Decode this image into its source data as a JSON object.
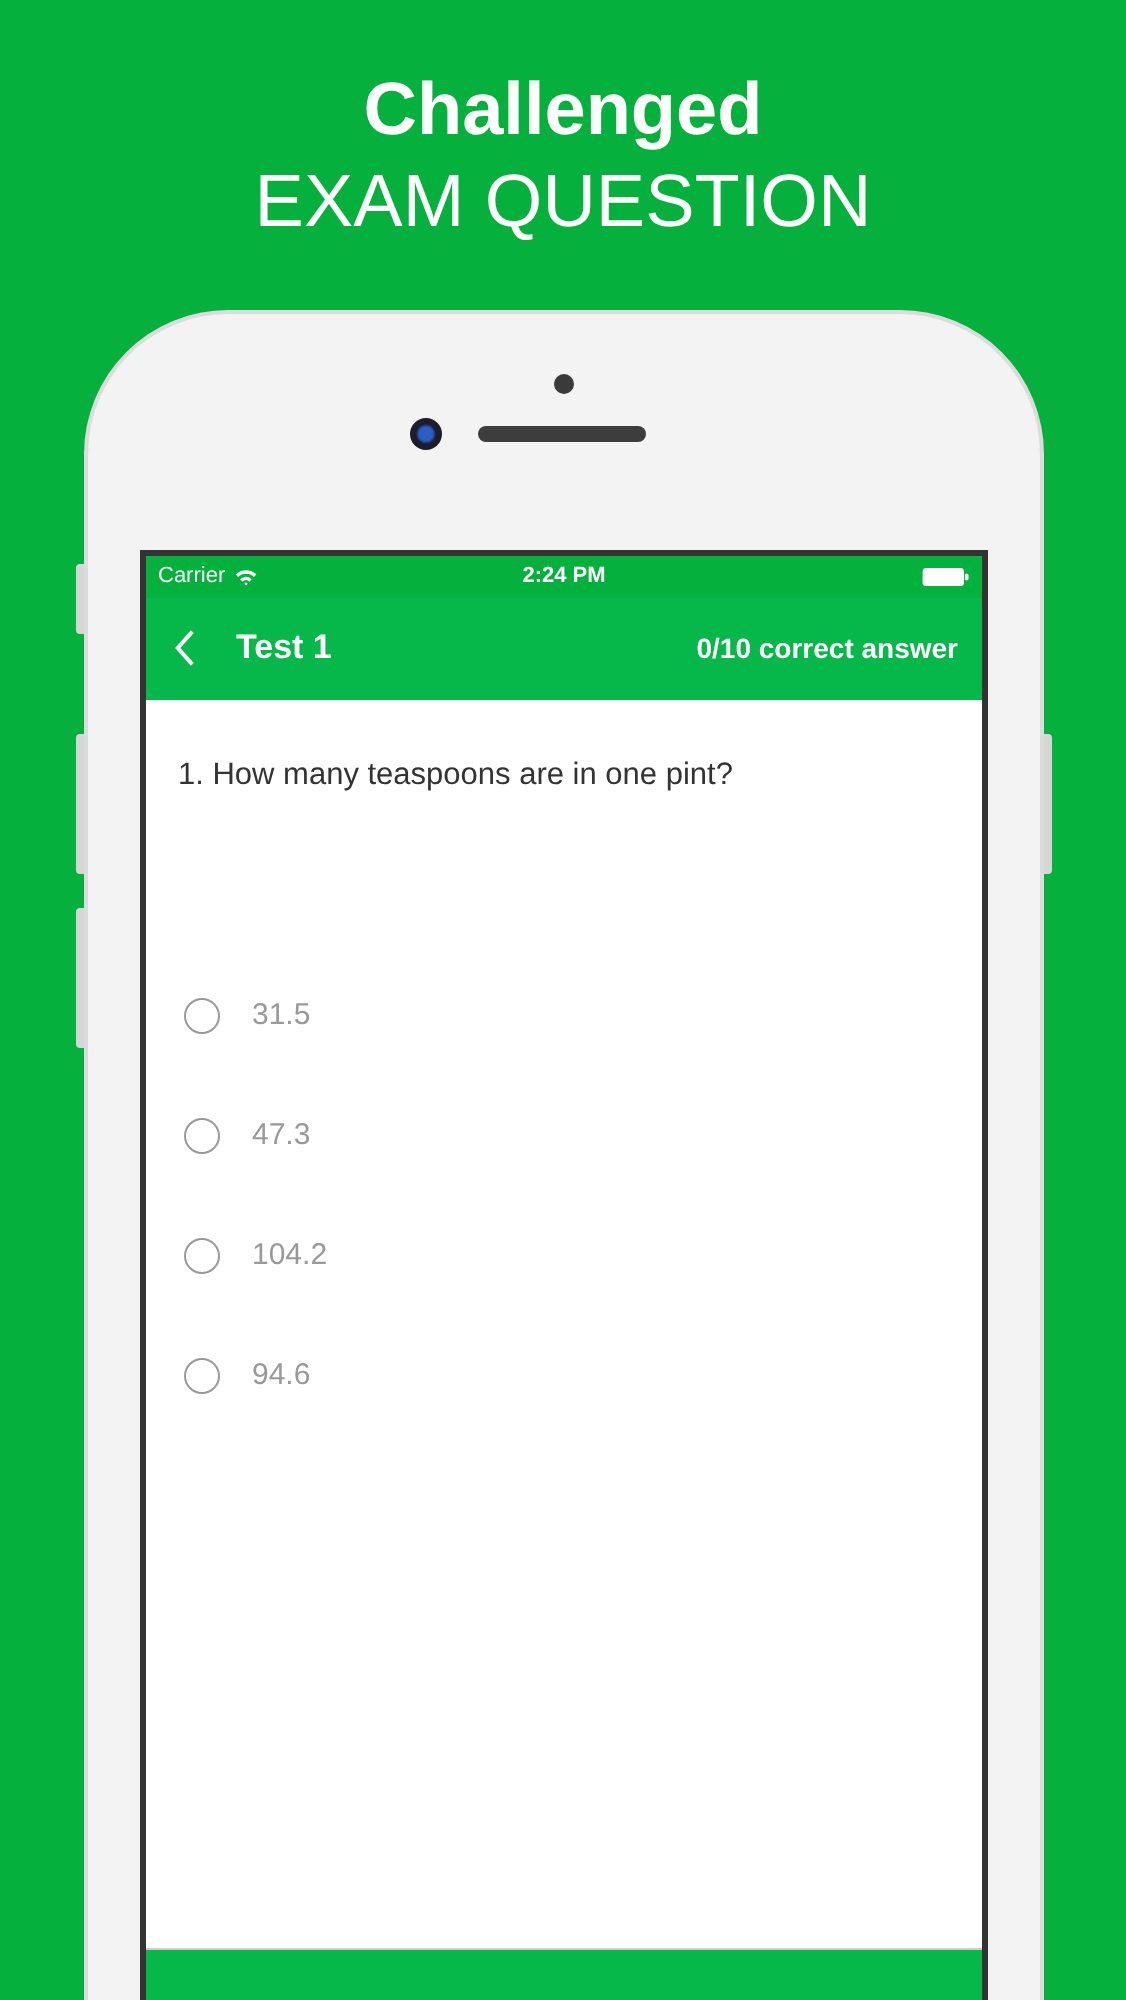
{
  "headline": {
    "title": "Challenged",
    "subtitle": "EXAM QUESTION"
  },
  "status_bar": {
    "carrier": "Carrier",
    "time": "2:24 PM"
  },
  "nav_bar": {
    "back_title": "Test 1",
    "score": "0/10 correct answer"
  },
  "question": "1. How many teaspoons are in one pint?",
  "options": [
    {
      "label": "31.5",
      "selected": false
    },
    {
      "label": "47.3",
      "selected": false
    },
    {
      "label": "104.2",
      "selected": false
    },
    {
      "label": "94.6",
      "selected": false
    }
  ]
}
